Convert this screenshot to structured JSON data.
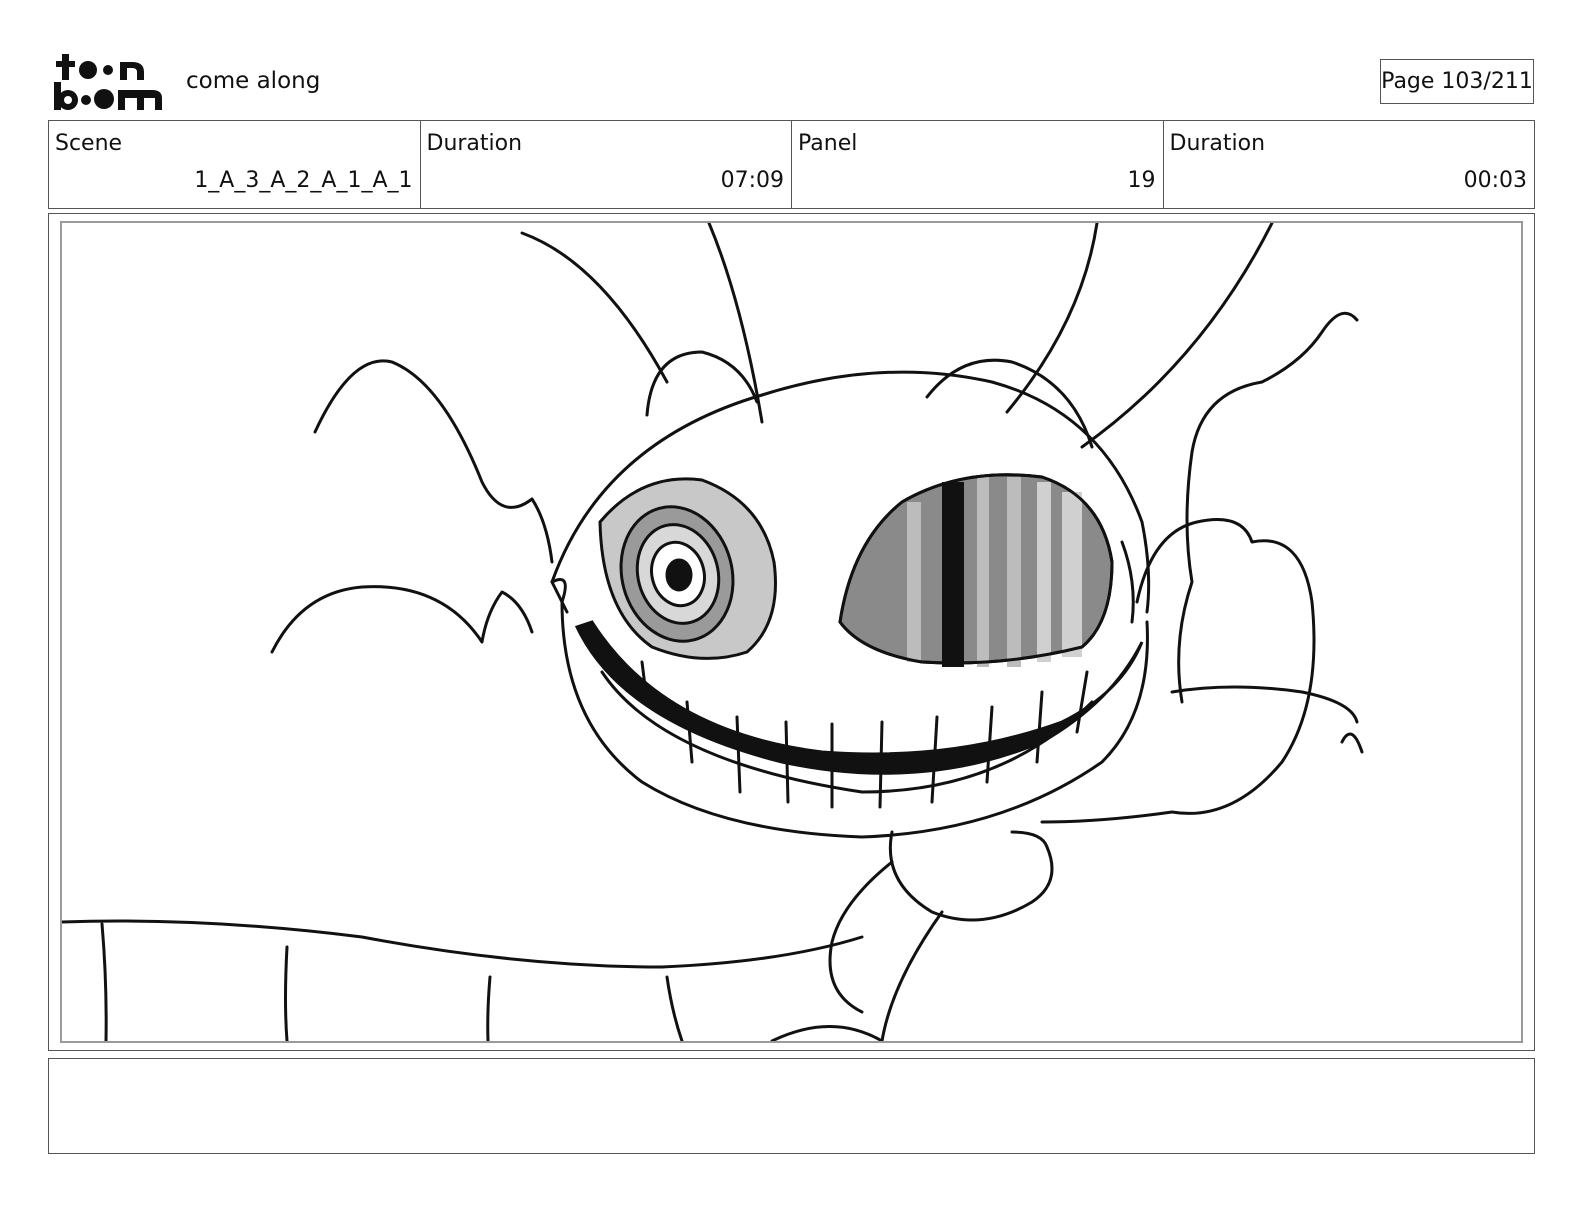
{
  "header": {
    "logo_text": "toon boom",
    "project_title": "come along",
    "page_label": "Page 103/211"
  },
  "info": {
    "scene_label": "Scene",
    "scene_value": "1_A_3_A_2_A_1_A_1",
    "scene_duration_label": "Duration",
    "scene_duration_value": "07:09",
    "panel_label": "Panel",
    "panel_value": "19",
    "panel_duration_label": "Duration",
    "panel_duration_value": "00:03"
  },
  "notes": {
    "text": ""
  }
}
